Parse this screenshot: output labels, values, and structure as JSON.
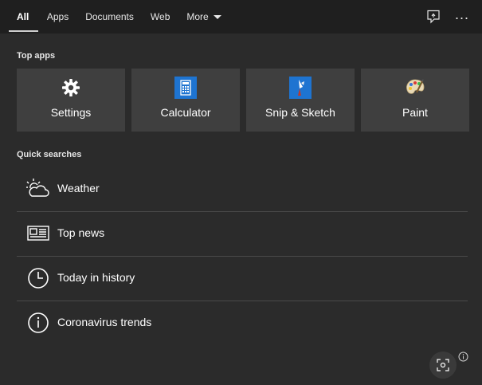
{
  "tabs": [
    {
      "label": "All"
    },
    {
      "label": "Apps"
    },
    {
      "label": "Documents"
    },
    {
      "label": "Web"
    },
    {
      "label": "More"
    }
  ],
  "top_icons": {
    "feedback": "feedback-icon",
    "more": "..."
  },
  "top_apps": {
    "title": "Top apps",
    "items": [
      {
        "label": "Settings",
        "icon": "gear-icon"
      },
      {
        "label": "Calculator",
        "icon": "calculator-icon"
      },
      {
        "label": "Snip & Sketch",
        "icon": "snip-sketch-icon"
      },
      {
        "label": "Paint",
        "icon": "paint-palette-icon"
      }
    ]
  },
  "quick_searches": {
    "title": "Quick searches",
    "items": [
      {
        "label": "Weather",
        "icon": "weather-icon"
      },
      {
        "label": "Top news",
        "icon": "newspaper-icon"
      },
      {
        "label": "Today in history",
        "icon": "clock-icon"
      },
      {
        "label": "Coronavirus trends",
        "icon": "info-icon"
      }
    ]
  },
  "colors": {
    "background": "#2b2b2b",
    "topbar": "#1f1f1f",
    "tile": "#3f3f3f",
    "accent": "#1e74d1"
  }
}
